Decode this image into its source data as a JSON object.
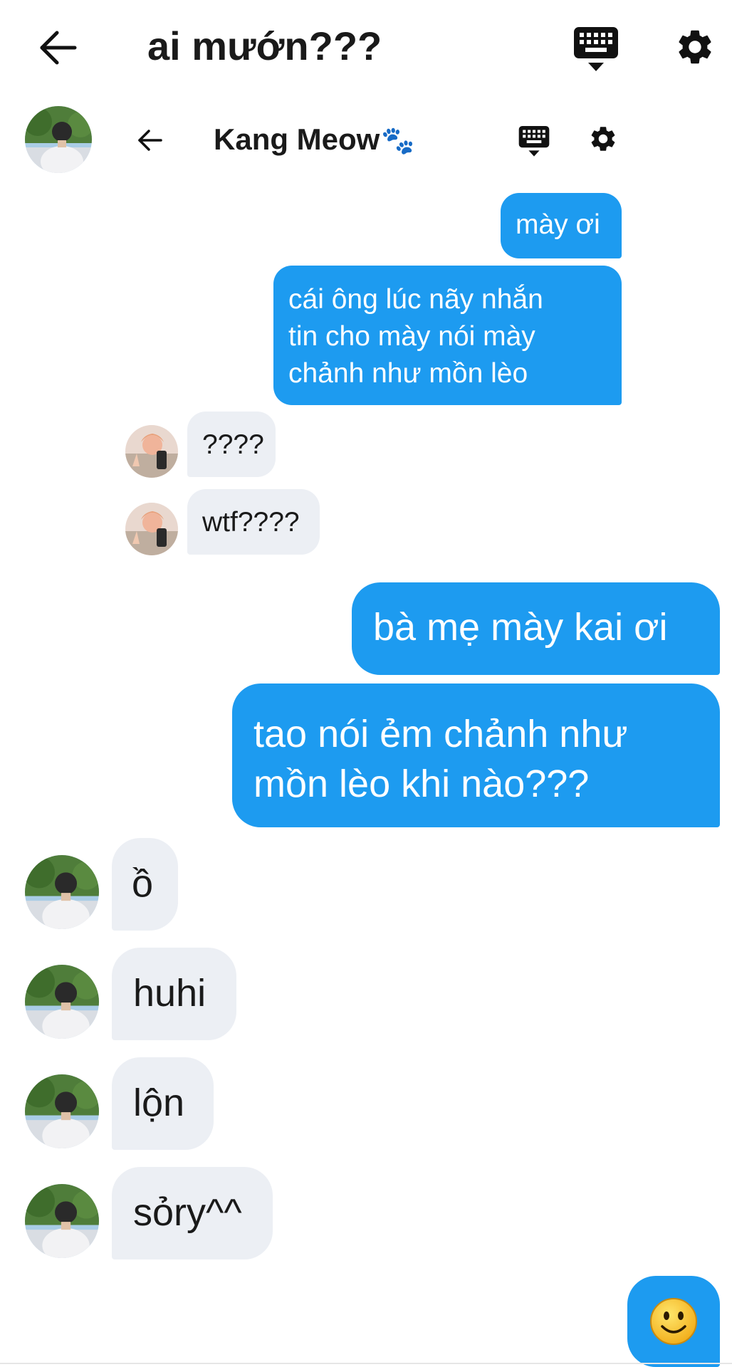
{
  "header": {
    "title": "ai mướn???"
  },
  "chat_header": {
    "name": "Kang Meow",
    "name_emoji": "🐾"
  },
  "messages": [
    {
      "side": "out",
      "text": "mày ơi"
    },
    {
      "side": "out",
      "text": "cái ông lúc nãy nhắn\ntin cho mày nói mày\nchảnh như mồn lèo"
    },
    {
      "side": "in",
      "text": "????"
    },
    {
      "side": "in",
      "text": "wtf????"
    },
    {
      "side": "out",
      "text": "bà mẹ mày kai ơi"
    },
    {
      "side": "out",
      "text": "tao nói ẻm chảnh như\nmồn lèo khi nào???"
    },
    {
      "side": "in",
      "text": "ồ"
    },
    {
      "side": "in",
      "text": "huhi"
    },
    {
      "side": "in",
      "text": "lộn"
    },
    {
      "side": "in",
      "text": "sỏry^^"
    }
  ],
  "icons": {
    "back": "arrow-left-icon",
    "keyboard": "keyboard-icon",
    "settings": "gear-icon",
    "emoji": "smiley-icon"
  },
  "colors": {
    "outgoing_bubble": "#1d9bf0",
    "incoming_bubble": "#eceff4",
    "text_dark": "#1a1a1a"
  }
}
